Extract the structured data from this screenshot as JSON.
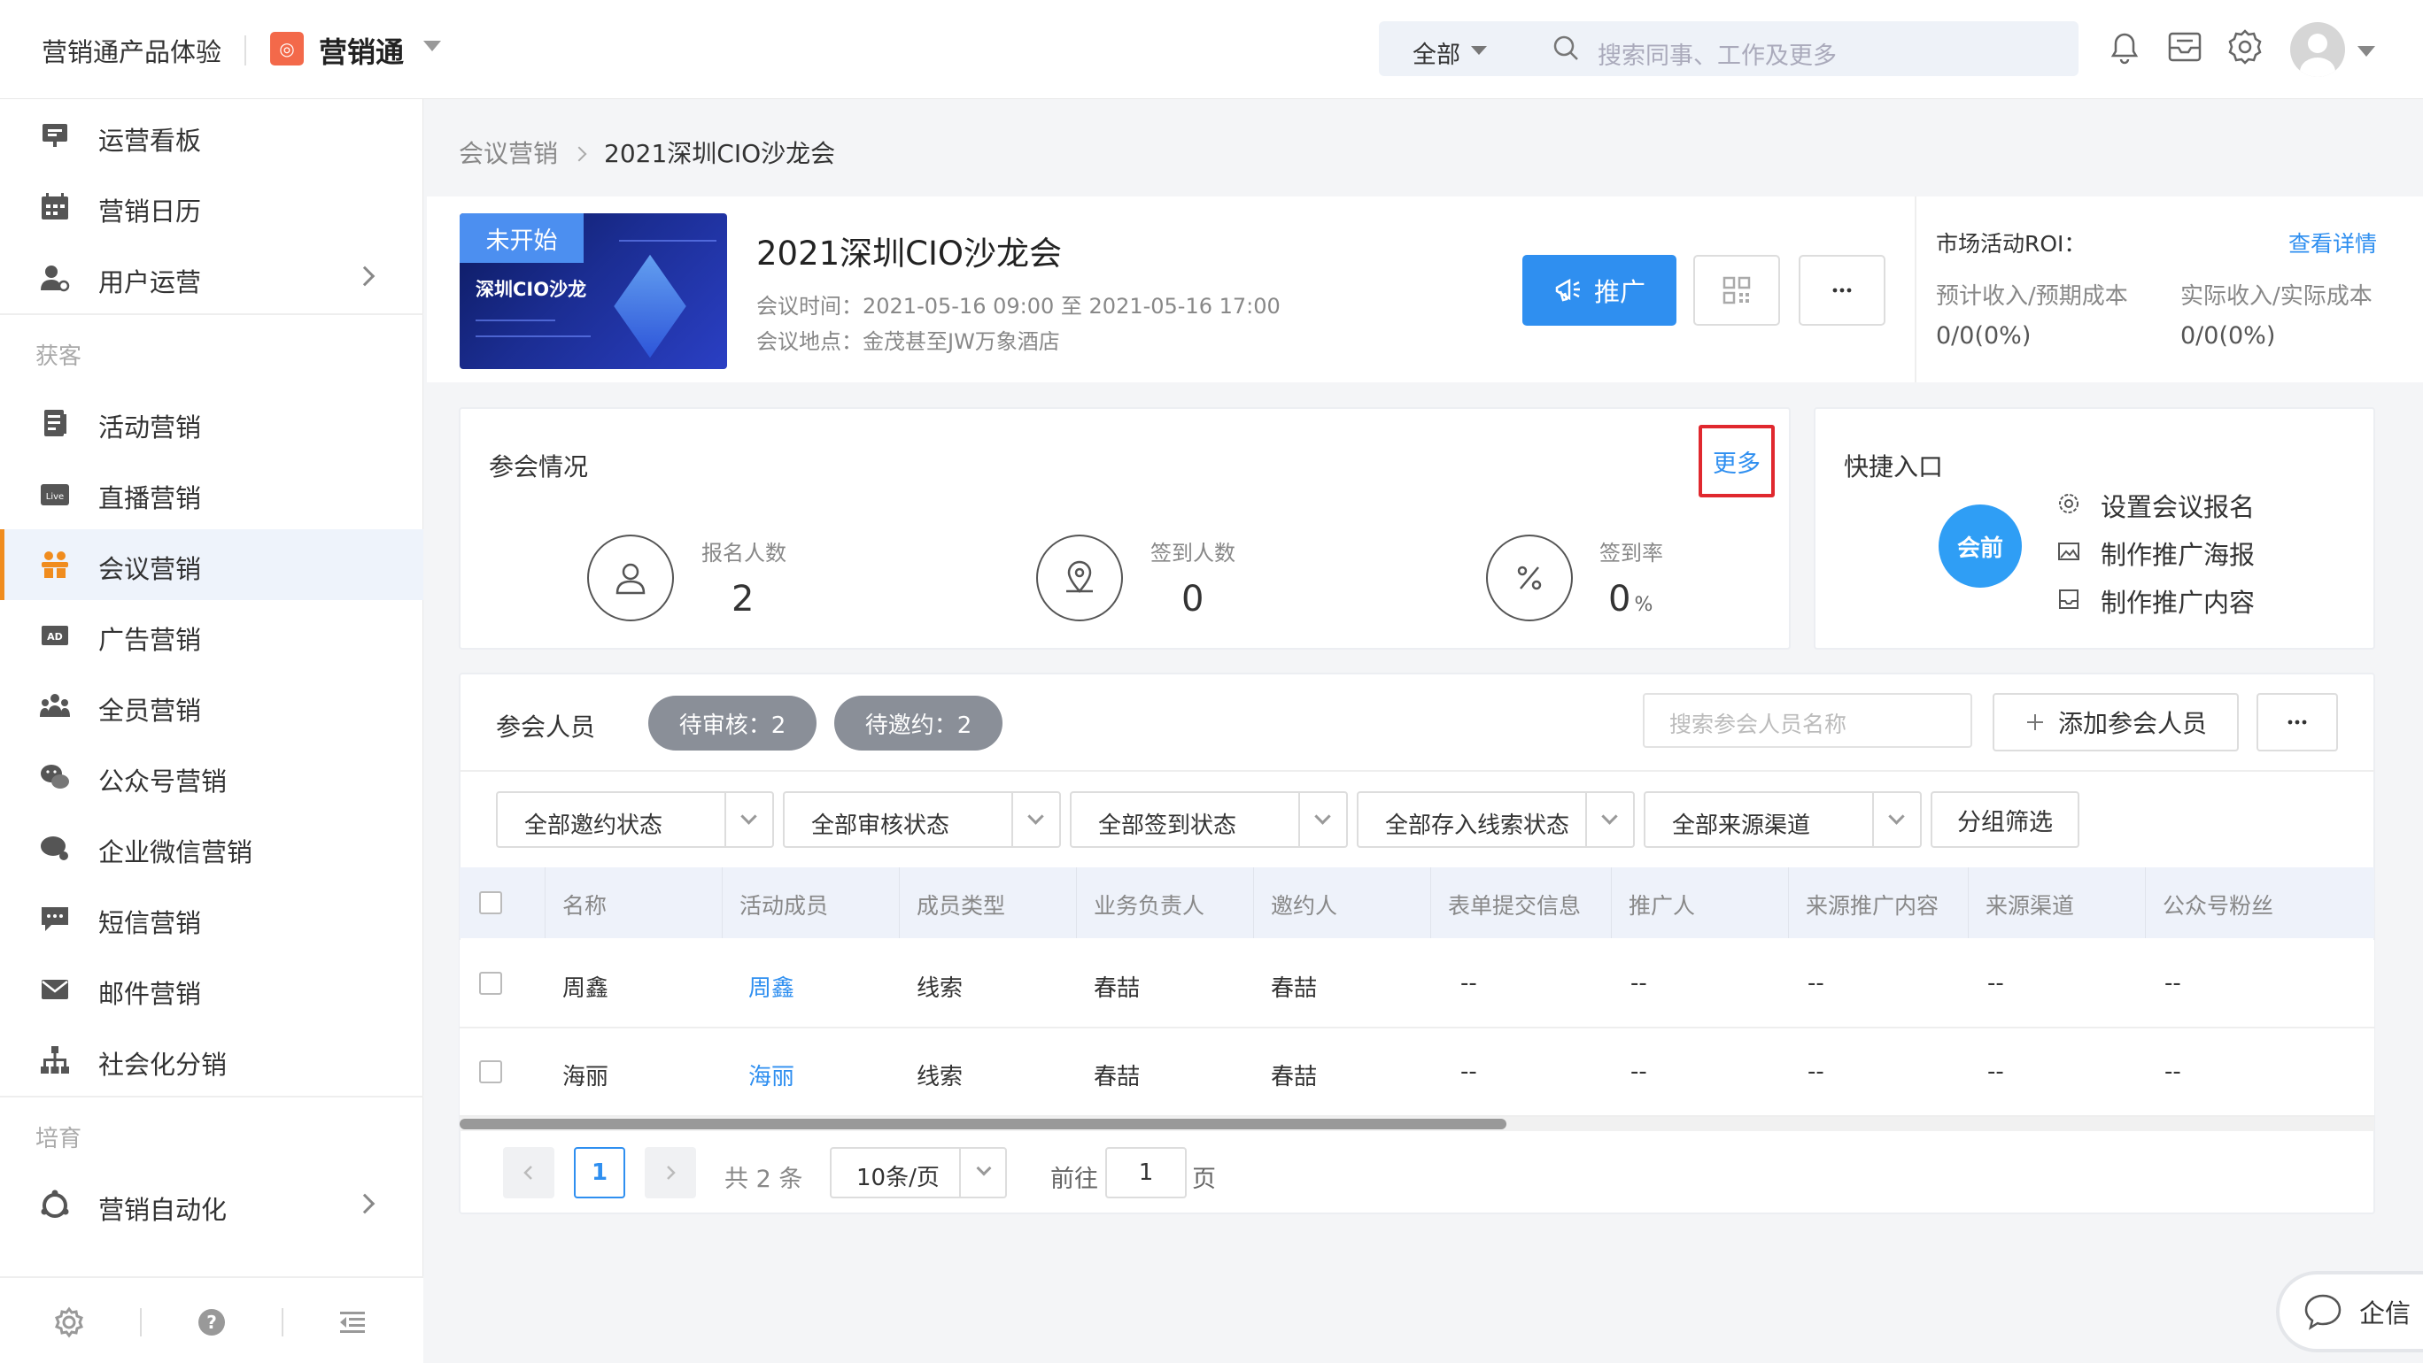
{
  "topbar": {
    "brand": "营销通产品体验",
    "app_name": "营销通",
    "search_scope": "全部",
    "search_placeholder": "搜索同事、工作及更多"
  },
  "sidebar": {
    "items_top": [
      {
        "label": "运营看板",
        "icon": "dashboard-icon"
      },
      {
        "label": "营销日历",
        "icon": "calendar-icon"
      },
      {
        "label": "用户运营",
        "icon": "user-ops-icon",
        "chevron": true
      }
    ],
    "group_acquire": "获客",
    "items_acquire": [
      {
        "label": "活动营销",
        "icon": "activity-icon"
      },
      {
        "label": "直播营销",
        "icon": "live-icon"
      },
      {
        "label": "会议营销",
        "icon": "meeting-icon",
        "active": true
      },
      {
        "label": "广告营销",
        "icon": "ad-icon"
      },
      {
        "label": "全员营销",
        "icon": "team-icon"
      },
      {
        "label": "公众号营销",
        "icon": "wechat-icon"
      },
      {
        "label": "企业微信营销",
        "icon": "wecom-icon"
      },
      {
        "label": "短信营销",
        "icon": "sms-icon"
      },
      {
        "label": "邮件营销",
        "icon": "mail-icon"
      },
      {
        "label": "社会化分销",
        "icon": "distribution-icon"
      }
    ],
    "group_nurture": "培育",
    "items_nurture": [
      {
        "label": "营销自动化",
        "icon": "automation-icon",
        "chevron": true
      }
    ]
  },
  "breadcrumb": {
    "parent": "会议营销",
    "current": "2021深圳CIO沙龙会"
  },
  "event": {
    "status_badge": "未开始",
    "poster_title": "深圳CIO沙龙",
    "title": "2021深圳CIO沙龙会",
    "time": "会议时间：2021-05-16 09:00 至 2021-05-16 17:00",
    "location": "会议地点：金茂甚至JW万象酒店",
    "promote_label": "推广"
  },
  "roi": {
    "title": "市场活动ROI：",
    "link": "查看详情",
    "label_expected": "预计收入/预期成本",
    "label_actual": "实际收入/实际成本",
    "value_expected": "0/0(0%)",
    "value_actual": "0/0(0%)"
  },
  "attendance": {
    "title": "参会情况",
    "more": "更多",
    "stats": [
      {
        "label": "报名人数",
        "value": "2",
        "unit": ""
      },
      {
        "label": "签到人数",
        "value": "0",
        "unit": ""
      },
      {
        "label": "签到率",
        "value": "0",
        "unit": "%"
      }
    ]
  },
  "quick_entry": {
    "title": "快捷入口",
    "stage": "会前",
    "items": [
      "设置会议报名",
      "制作推广海报",
      "制作推广内容"
    ]
  },
  "participants": {
    "title": "参会人员",
    "tag_pending_review": "待审核：2",
    "tag_pending_invite": "待邀约：2",
    "search_placeholder": "搜索参会人员名称",
    "add_label": "添加参会人员",
    "filters": [
      "全部邀约状态",
      "全部审核状态",
      "全部签到状态",
      "全部存入线索状态",
      "全部来源渠道"
    ],
    "group_filter": "分组筛选",
    "columns": [
      "名称",
      "活动成员",
      "成员类型",
      "业务负责人",
      "邀约人",
      "表单提交信息",
      "推广人",
      "来源推广内容",
      "来源渠道",
      "公众号粉丝"
    ],
    "rows": [
      [
        "周鑫",
        "周鑫",
        "线索",
        "春喆",
        "春喆",
        "--",
        "--",
        "--",
        "--",
        "--"
      ],
      [
        "海丽",
        "海丽",
        "线索",
        "春喆",
        "春喆",
        "--",
        "--",
        "--",
        "--",
        "--"
      ]
    ]
  },
  "pagination": {
    "current_page": "1",
    "total": "共 2 条",
    "page_size": "10条/页",
    "goto_label": "前往",
    "goto_value": "1",
    "page_suffix": "页"
  },
  "qixin": {
    "label": "企信"
  },
  "colors": {
    "accent": "#2f8ff0",
    "active_bar": "#f08c1e",
    "tag_gray": "#8a8f98",
    "highlight_border": "#e0282e"
  }
}
